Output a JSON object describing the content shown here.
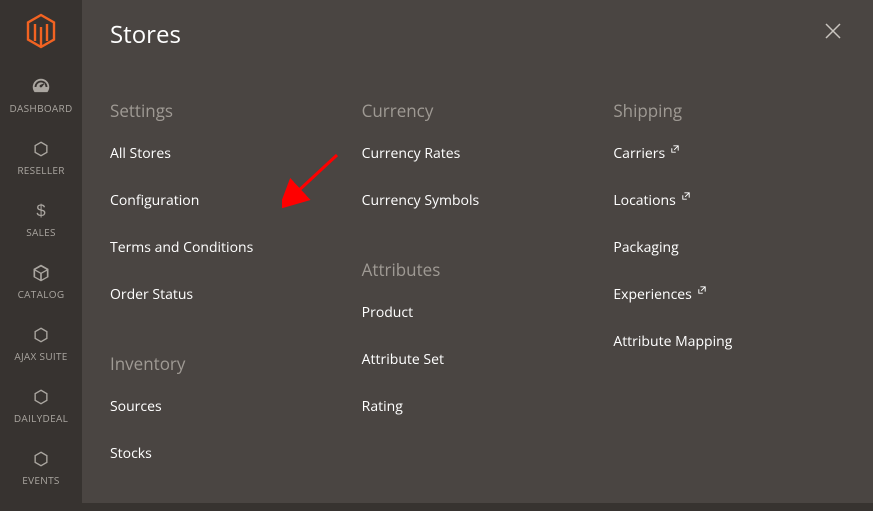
{
  "sidebar": {
    "items": [
      {
        "label": "DASHBOARD",
        "icon": "dashboard"
      },
      {
        "label": "RESELLER",
        "icon": "hex"
      },
      {
        "label": "SALES",
        "icon": "dollar"
      },
      {
        "label": "CATALOG",
        "icon": "cube"
      },
      {
        "label": "AJAX SUITE",
        "icon": "hex"
      },
      {
        "label": "DAILYDEAL",
        "icon": "hex"
      },
      {
        "label": "EVENTS",
        "icon": "hex"
      }
    ]
  },
  "flyout": {
    "title": "Stores",
    "columns": [
      {
        "sections": [
          {
            "title": "Settings",
            "links": [
              {
                "label": "All Stores",
                "external": false
              },
              {
                "label": "Configuration",
                "external": false
              },
              {
                "label": "Terms and Conditions",
                "external": false
              },
              {
                "label": "Order Status",
                "external": false
              }
            ]
          },
          {
            "title": "Inventory",
            "links": [
              {
                "label": "Sources",
                "external": false
              },
              {
                "label": "Stocks",
                "external": false
              }
            ]
          }
        ]
      },
      {
        "sections": [
          {
            "title": "Currency",
            "links": [
              {
                "label": "Currency Rates",
                "external": false
              },
              {
                "label": "Currency Symbols",
                "external": false
              }
            ]
          },
          {
            "title": "Attributes",
            "links": [
              {
                "label": "Product",
                "external": false
              },
              {
                "label": "Attribute Set",
                "external": false
              },
              {
                "label": "Rating",
                "external": false
              }
            ]
          }
        ]
      },
      {
        "sections": [
          {
            "title": "Shipping",
            "links": [
              {
                "label": "Carriers",
                "external": true
              },
              {
                "label": "Locations",
                "external": true
              },
              {
                "label": "Packaging",
                "external": false
              },
              {
                "label": "Experiences",
                "external": true
              },
              {
                "label": "Attribute Mapping",
                "external": false
              }
            ]
          }
        ]
      }
    ]
  },
  "annotation": {
    "arrow_target": "Configuration"
  }
}
